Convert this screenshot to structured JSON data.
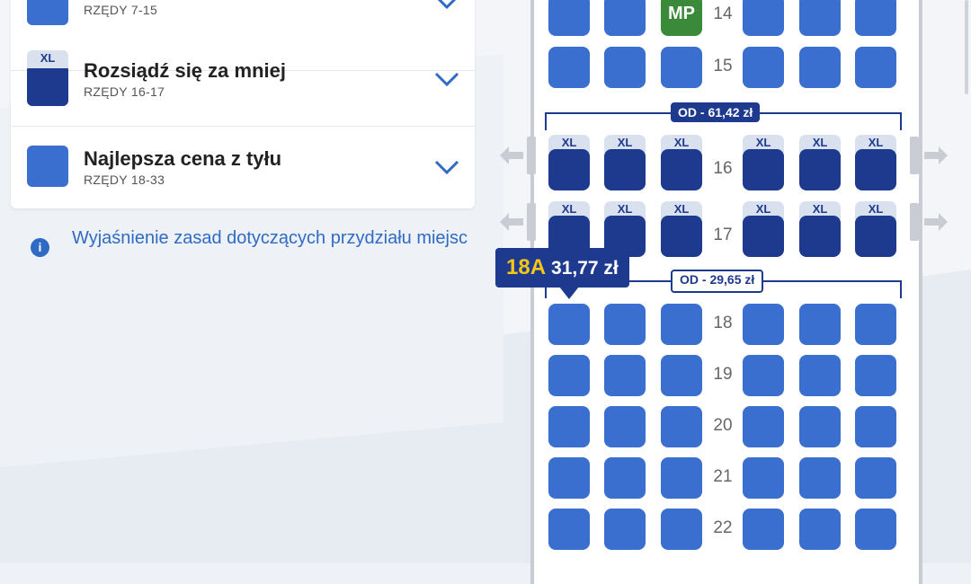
{
  "options": [
    {
      "title": "",
      "subtitle": "RZĘDY 7-15",
      "icon": "standard-seat-icon",
      "xl": false
    },
    {
      "title": "Rozsiądź się za mniej",
      "subtitle": "RZĘDY 16-17",
      "icon": "xl-seat-icon",
      "xl": true,
      "xl_label": "XL"
    },
    {
      "title": "Najlepsza cena z tyłu",
      "subtitle": "RZĘDY 18-33",
      "icon": "standard-seat-icon",
      "xl": false
    }
  ],
  "info": {
    "icon": "info-icon",
    "link": "Wyjaśnienie zasad dotyczących przydziału miejsc"
  },
  "seatmap": {
    "rows": [
      "14",
      "15",
      "16",
      "17",
      "18",
      "19",
      "20",
      "21",
      "22"
    ],
    "xl_label": "XL",
    "mp_label": "MP",
    "price_from_xl": "OD  - 61,42 zł",
    "price_from_std": "OD  - 29,65 zł",
    "selected_seat": "18A",
    "selected_price": "31,77 zł"
  },
  "colors": {
    "xl_seat": "#1d3a8f",
    "std_seat": "#3a6fd0",
    "mp_seat": "#3b8a3a",
    "accent": "#f5c518"
  }
}
